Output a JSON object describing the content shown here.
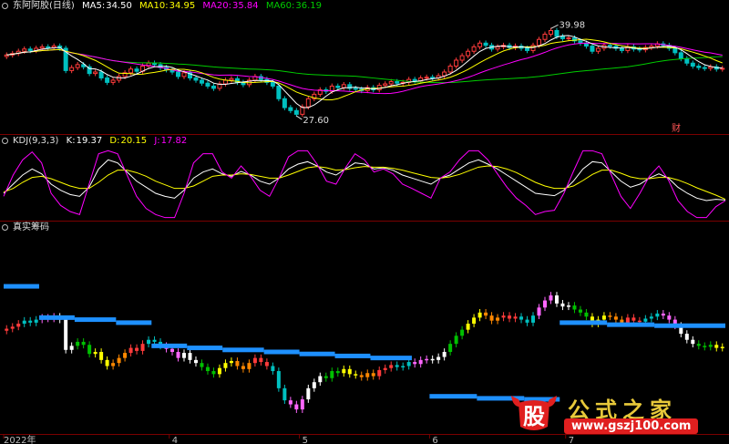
{
  "colors": {
    "up": "#ff3b3b",
    "down": "#00c0c0",
    "ma5": "#ffffff",
    "ma10": "#ffff00",
    "ma20": "#ff00ff",
    "ma60": "#00cc00",
    "kdj_k": "#ffffff",
    "kdj_d": "#ffff00",
    "kdj_j": "#ff00ff",
    "chip_bar": "#1e90ff",
    "sep": "#7a0000",
    "chip_colors": [
      "#ff3b3b",
      "#00c0c0",
      "#ff66ff",
      "#ffffff",
      "#00c000",
      "#ffff00",
      "#ff8800"
    ]
  },
  "header": {
    "price_title": "东阿阿胶(日线)",
    "ma5_label": "MA5:",
    "ma5_val": "34.50",
    "ma10_label": "MA10:",
    "ma10_val": "34.95",
    "ma20_label": "MA20:",
    "ma20_val": "35.84",
    "ma60_label": "MA60:",
    "ma60_val": "36.19",
    "kdj_title": "KDJ(9,3,3)",
    "k_label": "K:",
    "k_val": "19.37",
    "d_label": "D:",
    "d_val": "20.15",
    "j_label": "J:",
    "j_val": "17.82",
    "chip_title": "真实筹码"
  },
  "annotations": {
    "high": "39.98",
    "low": "27.60",
    "marker": "财"
  },
  "x_axis": {
    "labels": [
      "2022年",
      "4",
      "5",
      "6",
      "7"
    ]
  },
  "watermark": {
    "logo_char": "股",
    "text": "公式之家",
    "url": "www.gszj100.com"
  },
  "chart_data": [
    {
      "type": "candlestick",
      "title": "东阿阿胶(日线)",
      "y_range": [
        26.5,
        41.5
      ],
      "x": [
        "2022年",
        "4",
        "5",
        "6",
        "7"
      ],
      "closes": [
        36.3,
        36.5,
        36.8,
        37.1,
        36.9,
        37.2,
        37.4,
        37.3,
        37.5,
        37.2,
        34.2,
        34.6,
        35.0,
        34.7,
        33.8,
        34.0,
        33.2,
        32.6,
        32.9,
        33.4,
        33.9,
        34.4,
        34.1,
        34.8,
        35.2,
        35.0,
        34.6,
        34.3,
        34.0,
        33.4,
        33.9,
        33.2,
        32.9,
        32.5,
        32.1,
        31.8,
        32.4,
        32.9,
        33.1,
        32.6,
        32.3,
        32.9,
        33.4,
        33.0,
        32.6,
        32.1,
        30.4,
        29.2,
        28.8,
        28.3,
        29.3,
        30.4,
        31.0,
        31.6,
        31.4,
        32.1,
        31.9,
        32.3,
        31.8,
        31.7,
        31.5,
        31.9,
        31.6,
        32.2,
        32.4,
        32.7,
        32.5,
        32.6,
        33.0,
        32.8,
        33.2,
        33.3,
        33.2,
        33.5,
        34.0,
        34.8,
        35.6,
        36.2,
        36.8,
        37.4,
        37.9,
        37.6,
        37.1,
        37.4,
        37.6,
        37.3,
        37.5,
        37.2,
        36.9,
        37.6,
        38.4,
        39.1,
        39.6,
        38.8,
        38.5,
        38.6,
        38.2,
        37.9,
        37.5,
        36.8,
        37.2,
        37.6,
        37.5,
        37.2,
        36.9,
        37.4,
        37.1,
        37.0,
        37.3,
        37.5,
        37.8,
        37.6,
        37.2,
        36.6,
        35.8,
        35.2,
        34.8,
        34.6,
        34.5,
        34.7,
        34.4,
        34.5
      ],
      "ma5_last": 34.5,
      "ma10_last": 34.95,
      "ma20_last": 35.84,
      "ma60_last": 36.19,
      "high_label": 39.98,
      "low_label": 27.6
    },
    {
      "type": "line",
      "title": "KDJ(9,3,3)",
      "y_range": [
        0,
        100
      ],
      "series": [
        {
          "name": "K",
          "values": [
            30,
            45,
            60,
            70,
            62,
            45,
            35,
            28,
            25,
            40,
            70,
            85,
            80,
            65,
            50,
            40,
            30,
            25,
            22,
            35,
            55,
            65,
            70,
            62,
            58,
            66,
            60,
            50,
            45,
            55,
            70,
            78,
            82,
            75,
            65,
            60,
            70,
            80,
            78,
            70,
            72,
            68,
            60,
            55,
            50,
            45,
            55,
            60,
            70,
            80,
            85,
            78,
            70,
            60,
            50,
            40,
            30,
            28,
            26,
            35,
            50,
            70,
            82,
            80,
            65,
            50,
            40,
            45,
            55,
            62,
            55,
            40,
            30,
            22,
            18,
            20,
            19
          ]
        },
        {
          "name": "D",
          "values": [
            32,
            38,
            48,
            56,
            58,
            54,
            48,
            42,
            38,
            38,
            48,
            60,
            68,
            68,
            64,
            58,
            50,
            44,
            38,
            38,
            42,
            50,
            58,
            60,
            60,
            62,
            61,
            58,
            55,
            55,
            60,
            66,
            72,
            74,
            72,
            68,
            69,
            72,
            74,
            73,
            73,
            71,
            68,
            64,
            60,
            56,
            55,
            57,
            61,
            67,
            73,
            75,
            74,
            70,
            64,
            56,
            48,
            42,
            38,
            38,
            42,
            51,
            61,
            68,
            68,
            63,
            57,
            54,
            54,
            56,
            56,
            52,
            46,
            39,
            33,
            27,
            20.15
          ]
        },
        {
          "name": "J",
          "values": [
            25,
            60,
            85,
            98,
            80,
            30,
            10,
            0,
            -5,
            45,
            95,
            100,
            95,
            60,
            25,
            5,
            -5,
            -10,
            -10,
            30,
            80,
            95,
            95,
            65,
            55,
            75,
            58,
            35,
            25,
            55,
            90,
            100,
            100,
            78,
            50,
            45,
            72,
            95,
            85,
            65,
            70,
            62,
            45,
            38,
            30,
            22,
            55,
            65,
            85,
            100,
            100,
            85,
            62,
            40,
            22,
            10,
            -5,
            0,
            2,
            30,
            66,
            100,
            100,
            95,
            60,
            25,
            5,
            30,
            58,
            75,
            52,
            18,
            0,
            -10,
            -10,
            8,
            17.82
          ]
        }
      ],
      "k_last": 19.37,
      "d_last": 20.15,
      "j_last": 17.82
    },
    {
      "type": "bar",
      "title": "真实筹码",
      "y_range": [
        26.5,
        41.5
      ],
      "segments": [
        {
          "price": 40.5,
          "from": 0,
          "to": 6
        },
        {
          "price": 37.4,
          "from": 6,
          "to": 12
        },
        {
          "price": 37.2,
          "from": 12,
          "to": 19
        },
        {
          "price": 36.9,
          "from": 19,
          "to": 25
        },
        {
          "price": 34.6,
          "from": 25,
          "to": 31
        },
        {
          "price": 34.4,
          "from": 31,
          "to": 37
        },
        {
          "price": 34.2,
          "from": 37,
          "to": 44
        },
        {
          "price": 34.0,
          "from": 44,
          "to": 50
        },
        {
          "price": 33.8,
          "from": 50,
          "to": 56
        },
        {
          "price": 33.6,
          "from": 56,
          "to": 62
        },
        {
          "price": 33.4,
          "from": 62,
          "to": 69
        },
        {
          "price": 29.6,
          "from": 72,
          "to": 80
        },
        {
          "price": 29.4,
          "from": 80,
          "to": 88
        },
        {
          "price": 29.3,
          "from": 88,
          "to": 94
        },
        {
          "price": 36.9,
          "from": 94,
          "to": 102
        },
        {
          "price": 36.7,
          "from": 102,
          "to": 110
        },
        {
          "price": 36.6,
          "from": 110,
          "to": 122
        }
      ]
    }
  ]
}
